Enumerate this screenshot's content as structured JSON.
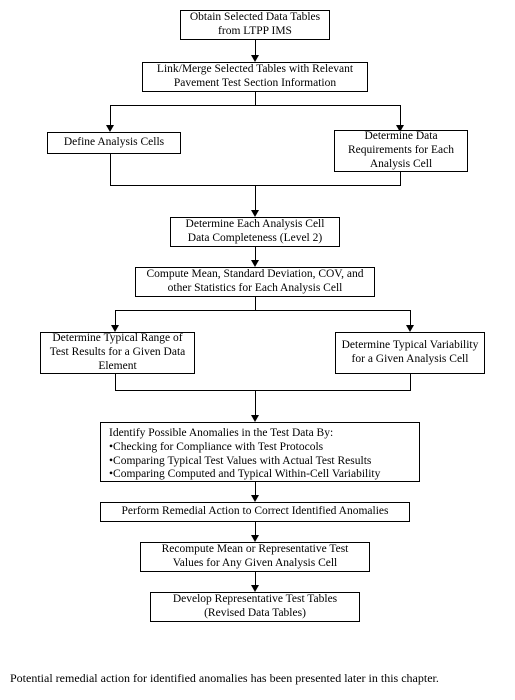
{
  "boxes": {
    "b1": "Obtain Selected Data Tables from LTPP IMS",
    "b2": "Link/Merge Selected Tables with Relevant Pavement Test Section Information",
    "b3": "Define Analysis Cells",
    "b4": "Determine Data Requirements for Each Analysis Cell",
    "b5": "Determine Each Analysis Cell Data Completeness (Level 2)",
    "b6": "Compute Mean, Standard Deviation, COV, and other Statistics for Each Analysis Cell",
    "b7": "Determine Typical Range of Test Results for a Given Data Element",
    "b8": "Determine Typical Variability for a Given Analysis Cell",
    "b9_title": "Identify Possible Anomalies in the Test Data By:",
    "b9_i1": "•Checking for Compliance with Test Protocols",
    "b9_i2": "•Comparing Typical Test Values with Actual Test Results",
    "b9_i3": "•Comparing Computed and Typical Within-Cell Variability",
    "b10": "Perform Remedial Action to Correct Identified Anomalies",
    "b11": "Recompute Mean or Representative Test Values for Any Given Analysis Cell",
    "b12": "Develop Representative Test Tables (Revised Data Tables)"
  },
  "footer": "Potential remedial action for identified anomalies has been presented later in this chapter."
}
